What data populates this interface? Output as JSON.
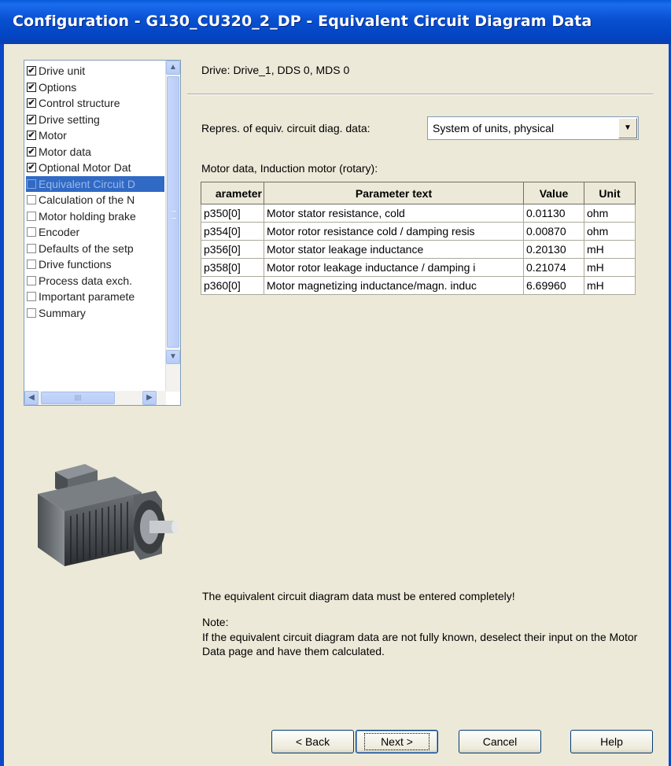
{
  "window": {
    "title": "Configuration - G130_CU320_2_DP - Equivalent Circuit Diagram Data"
  },
  "tree": {
    "items": [
      {
        "label": "Drive unit",
        "checked": true,
        "selected": false
      },
      {
        "label": "Options",
        "checked": true,
        "selected": false
      },
      {
        "label": "Control structure",
        "checked": true,
        "selected": false
      },
      {
        "label": "Drive setting",
        "checked": true,
        "selected": false
      },
      {
        "label": "Motor",
        "checked": true,
        "selected": false
      },
      {
        "label": "Motor data",
        "checked": true,
        "selected": false
      },
      {
        "label": "Optional Motor Dat",
        "checked": true,
        "selected": false
      },
      {
        "label": "Equivalent Circuit D",
        "checked": false,
        "selected": true
      },
      {
        "label": "Calculation of the N",
        "checked": false,
        "selected": false
      },
      {
        "label": "Motor holding brake",
        "checked": false,
        "selected": false
      },
      {
        "label": "Encoder",
        "checked": false,
        "selected": false
      },
      {
        "label": "Defaults of the setp",
        "checked": false,
        "selected": false
      },
      {
        "label": "Drive functions",
        "checked": false,
        "selected": false
      },
      {
        "label": "Process data exch.",
        "checked": false,
        "selected": false
      },
      {
        "label": "Important paramete",
        "checked": false,
        "selected": false
      },
      {
        "label": "Summary",
        "checked": false,
        "selected": false
      }
    ]
  },
  "drive_info": "Drive: Drive_1, DDS 0, MDS 0",
  "repres": {
    "label": "Repres. of equiv. circuit diag. data:",
    "value": "System of units, physical"
  },
  "motor_data_label": "Motor data, Induction motor (rotary):",
  "table": {
    "headers": [
      "arameter",
      "Parameter text",
      "Value",
      "Unit"
    ],
    "rows": [
      [
        "p350[0]",
        "Motor stator resistance, cold",
        "0.01130",
        "ohm"
      ],
      [
        "p354[0]",
        "Motor rotor resistance cold / damping resis",
        "0.00870",
        "ohm"
      ],
      [
        "p356[0]",
        "Motor stator leakage inductance",
        "0.20130",
        "mH"
      ],
      [
        "p358[0]",
        "Motor rotor leakage inductance / damping i",
        "0.21074",
        "mH"
      ],
      [
        "p360[0]",
        "Motor magnetizing inductance/magn. induc",
        "6.69960",
        "mH"
      ]
    ]
  },
  "message": "The equivalent circuit diagram data must be entered completely!",
  "note": {
    "label": "Note:",
    "text": "If the equivalent circuit diagram data are not fully known, deselect their input on the Motor Data page and have them calculated."
  },
  "buttons": {
    "back": "< Back",
    "next": "Next >",
    "cancel": "Cancel",
    "help": "Help"
  },
  "colors": {
    "title_bar": "#0a50d0",
    "selection": "#316ac5",
    "dialog_bg": "#ece9d8"
  }
}
